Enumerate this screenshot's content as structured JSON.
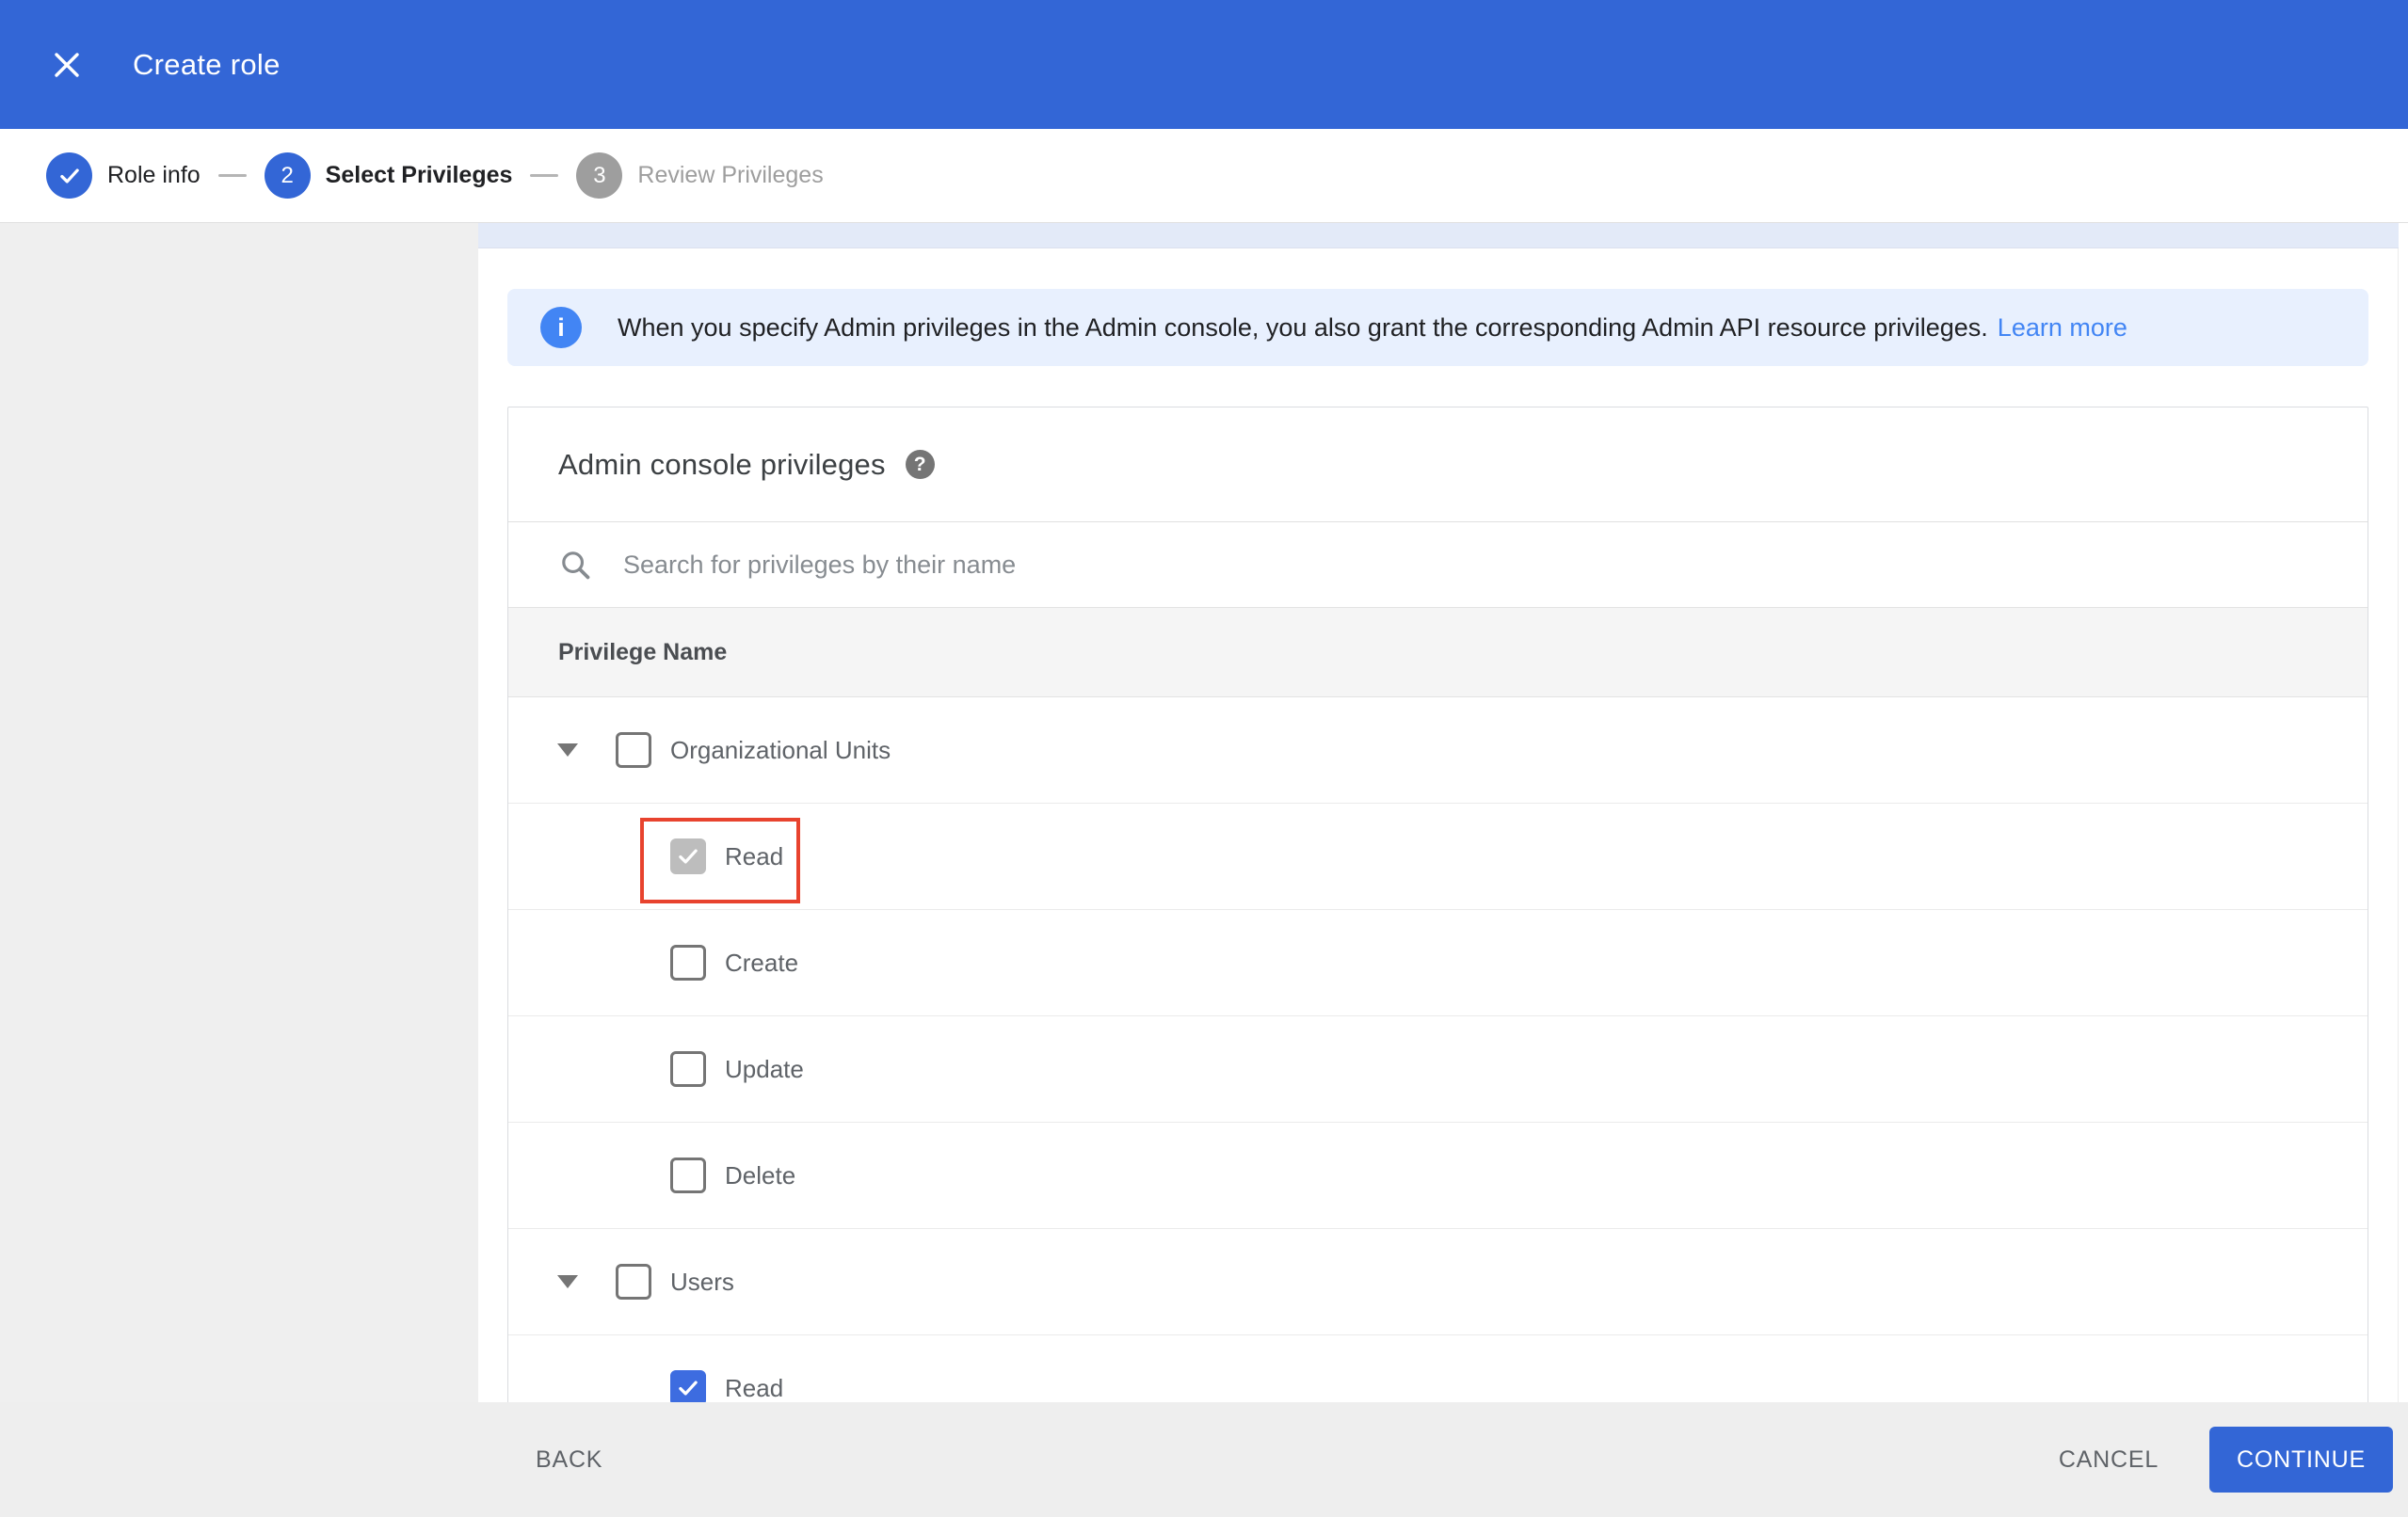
{
  "colors": {
    "primary": "#3366d6",
    "info_icon": "#4285f4",
    "banner_bg": "#e8f0fe",
    "link": "#4285f4",
    "annotation_highlight": "#e8432e",
    "checkbox_disabled_checked": "#bdbdbd",
    "checkbox_checked": "#3d6ce0",
    "inactive_step": "#9e9e9e"
  },
  "appbar": {
    "title": "Create role"
  },
  "stepper": {
    "steps": [
      {
        "label": "Role info",
        "status": "done",
        "icon": "check"
      },
      {
        "number": "2",
        "label": "Select Privileges",
        "status": "active"
      },
      {
        "number": "3",
        "label": "Review Privileges",
        "status": "upcoming"
      }
    ]
  },
  "banner": {
    "text": "When you specify Admin privileges in the Admin console, you also grant the corresponding Admin API resource privileges.",
    "link": "Learn more"
  },
  "privileges_card": {
    "title": "Admin console privileges",
    "help_glyph": "?",
    "info_glyph": "i",
    "search_placeholder": "Search for privileges by their name",
    "search_value": "",
    "column_header": "Privilege Name",
    "rows": [
      {
        "label": "Organizational Units",
        "type": "group",
        "expanded": true,
        "checked": false
      },
      {
        "label": "Read",
        "type": "child",
        "checked": true,
        "disabled": true,
        "highlighted": true
      },
      {
        "label": "Create",
        "type": "child",
        "checked": false
      },
      {
        "label": "Update",
        "type": "child",
        "checked": false
      },
      {
        "label": "Delete",
        "type": "child",
        "checked": false
      },
      {
        "label": "Users",
        "type": "group",
        "expanded": true,
        "checked": false
      },
      {
        "label": "Read",
        "type": "child",
        "checked": true
      }
    ]
  },
  "footer": {
    "back": "BACK",
    "cancel": "CANCEL",
    "continue": "CONTINUE"
  }
}
